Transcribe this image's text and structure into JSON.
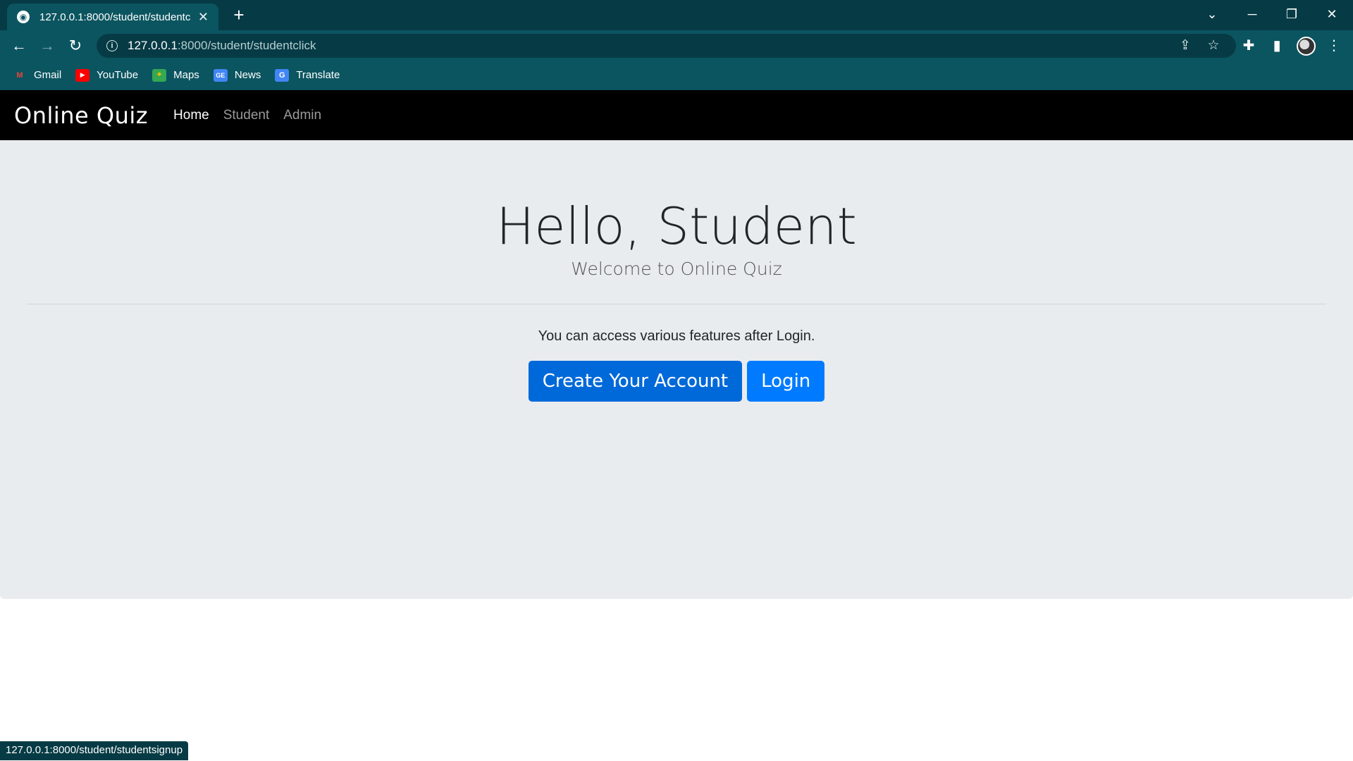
{
  "browser": {
    "tab_title": "127.0.0.1:8000/student/studentclick",
    "new_tab": "+",
    "url_host": "127.0.0.1",
    "url_path": ":8000/student/studentclick",
    "bookmarks": [
      {
        "label": "Gmail",
        "icon": "gmail-icon",
        "color": "#ea4335"
      },
      {
        "label": "YouTube",
        "icon": "youtube-icon",
        "color": "#ff0000"
      },
      {
        "label": "Maps",
        "icon": "maps-icon",
        "color": "#34a853"
      },
      {
        "label": "News",
        "icon": "news-icon",
        "color": "#4285f4"
      },
      {
        "label": "Translate",
        "icon": "translate-icon",
        "color": "#4285f4"
      }
    ],
    "status_url": "127.0.0.1:8000/student/studentsignup"
  },
  "site": {
    "brand": "Online Quiz",
    "nav": [
      {
        "label": "Home",
        "active": true
      },
      {
        "label": "Student",
        "active": false
      },
      {
        "label": "Admin",
        "active": false
      }
    ]
  },
  "hero": {
    "title": "Hello, Student",
    "lead": "Welcome to Online Quiz",
    "text": "You can access various features after Login.",
    "create_button": "Create Your Account",
    "login_button": "Login"
  },
  "colors": {
    "browser_frame": "#063b45",
    "toolbar": "#0b5560",
    "navbar": "#000000",
    "jumbotron": "#e9ecef",
    "button_primary": "#007bff"
  }
}
